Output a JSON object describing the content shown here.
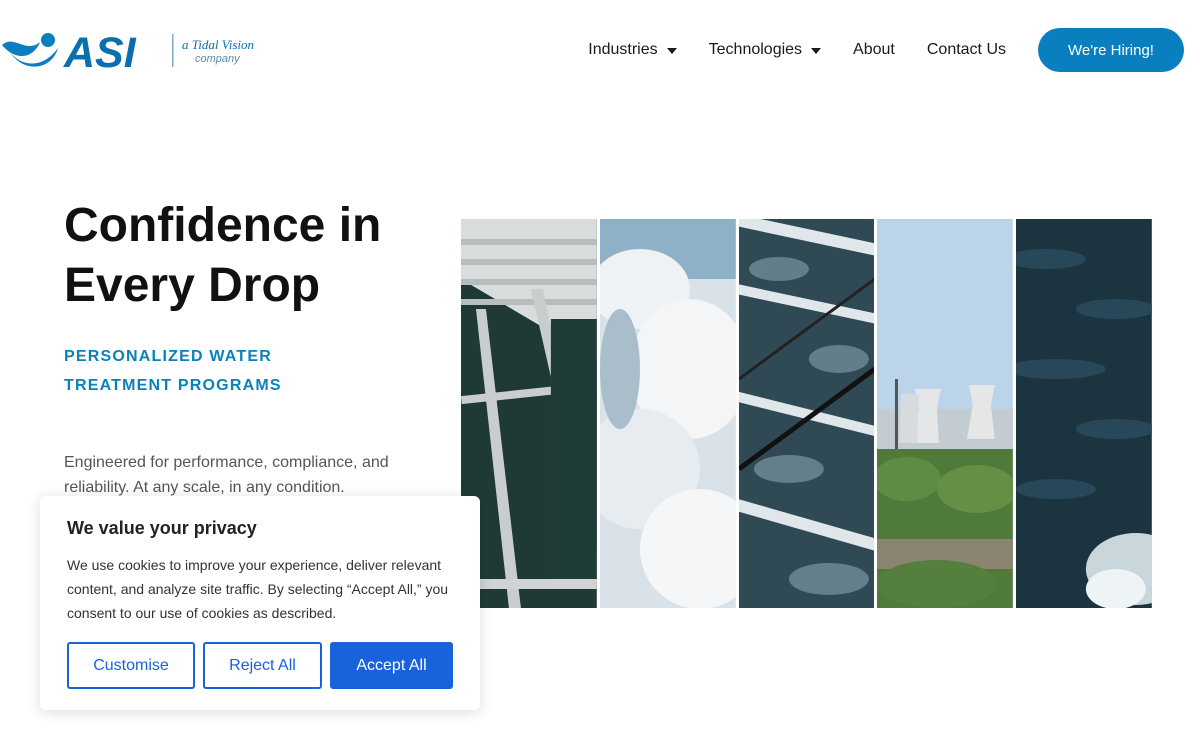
{
  "header": {
    "logo": {
      "icon": "wave-logo-icon",
      "wordmark": "ASI",
      "tagline_line1": "a Tidal Vision",
      "tagline_line2": "company"
    },
    "nav": [
      {
        "label": "Industries",
        "has_dropdown": true
      },
      {
        "label": "Technologies",
        "has_dropdown": true
      },
      {
        "label": "About",
        "has_dropdown": false
      },
      {
        "label": "Contact Us",
        "has_dropdown": false
      }
    ],
    "cta_label": "We're Hiring!"
  },
  "hero": {
    "title_line1": "Confidence in",
    "title_line2": "Every Drop",
    "subtitle_line1": "PERSONALIZED WATER",
    "subtitle_line2": "TREATMENT PROGRAMS",
    "description": "Engineered for performance, compliance, and reliability. At any scale, in any condition.",
    "images": [
      "aerial-treatment-plant-image",
      "whitewater-image",
      "aeration-tanks-image",
      "cooling-towers-image",
      "dark-water-image"
    ]
  },
  "cookie_banner": {
    "title": "We value your privacy",
    "text": "We use cookies to improve your experience, deliver relevant content, and analyze site traffic. By selecting “Accept All,” you consent to our use of cookies as described.",
    "buttons": {
      "customise": "Customise",
      "reject": "Reject All",
      "accept": "Accept All"
    }
  },
  "colors": {
    "accent": "#0a7fc0",
    "subtitle": "#0a82b8",
    "cookie_button": "#1863dc"
  }
}
